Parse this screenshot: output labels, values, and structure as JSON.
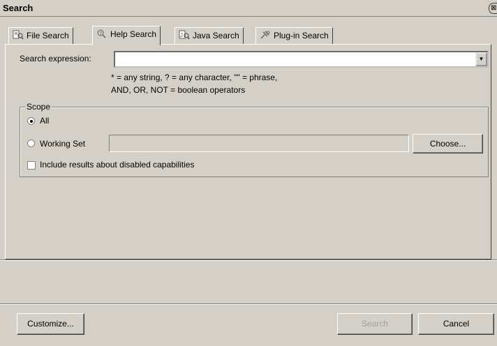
{
  "window": {
    "title": "Search",
    "close_glyph": "⊠"
  },
  "tabs": [
    {
      "label": "File Search",
      "icon": "file-search-icon",
      "active": false
    },
    {
      "label": "Help Search",
      "icon": "help-search-icon",
      "active": true
    },
    {
      "label": "Java Search",
      "icon": "java-search-icon",
      "active": false
    },
    {
      "label": "Plug-in Search",
      "icon": "plugin-search-icon",
      "active": false
    }
  ],
  "search": {
    "label": "Search expression:",
    "value": "",
    "hint_line1": "* = any string, ? = any character, \"\" = phrase,",
    "hint_line2": "AND, OR, NOT = boolean operators"
  },
  "scope": {
    "legend": "Scope",
    "option_all": "All",
    "option_working_set": "Working Set",
    "selected": "All",
    "working_set_value": "",
    "choose_label": "Choose...",
    "include_disabled_label": "Include results about disabled capabilities",
    "include_disabled_checked": false
  },
  "buttons": {
    "customize": "Customize...",
    "search": "Search",
    "cancel": "Cancel"
  },
  "colors": {
    "face": "#d4d0c8",
    "shadow": "#808080",
    "disabled_text": "#a0a0a0"
  }
}
